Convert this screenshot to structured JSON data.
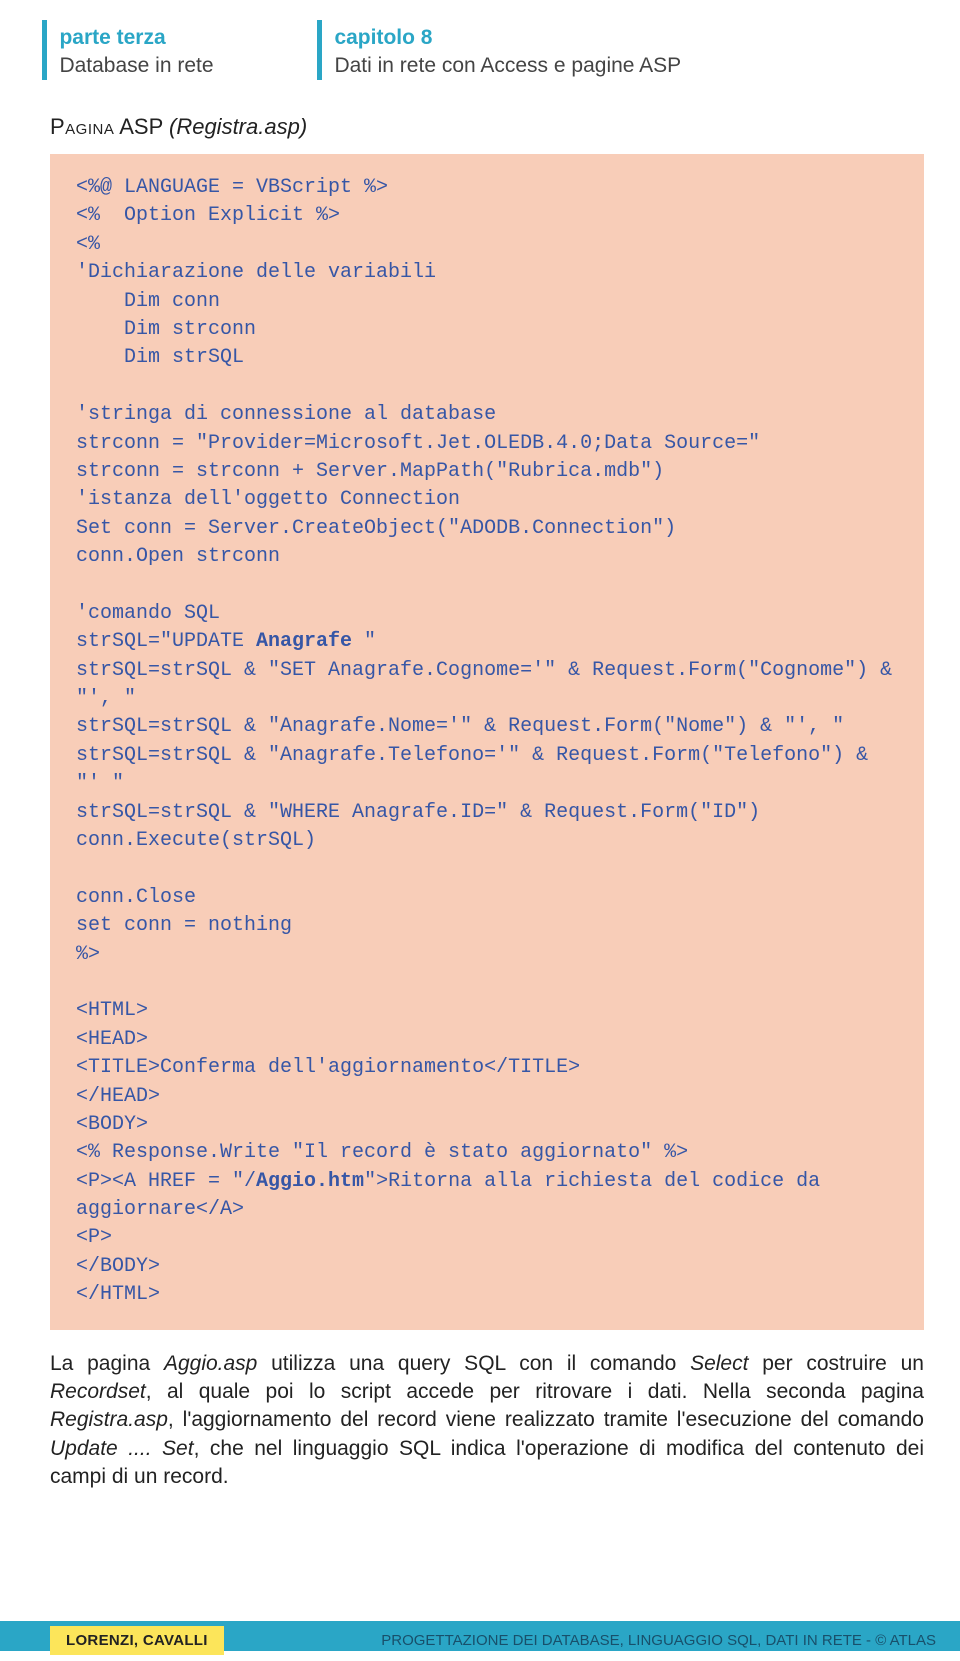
{
  "header": {
    "left": {
      "part_label": "parte terza",
      "sub_label": "Database in rete"
    },
    "right": {
      "chapter_label": "capitolo 8",
      "sub_label": "Dati in rete con Access e pagine ASP"
    }
  },
  "page_title": {
    "smallcaps": "Pagina",
    "rest": " ASP ",
    "italic": "(Registra.asp)"
  },
  "code": {
    "block1": "<%@ LANGUAGE = VBScript %>\n<%  Option Explicit %>\n<%\n'Dichiarazione delle variabili\n    Dim conn\n    Dim strconn\n    Dim strSQL\n\n'stringa di connessione al database\nstrconn = \"Provider=Microsoft.Jet.OLEDB.4.0;Data Source=\"\nstrconn = strconn + Server.MapPath(\"Rubrica.mdb\")\n'istanza dell'oggetto Connection\nSet conn = Server.CreateObject(\"ADODB.Connection\")\nconn.Open strconn\n\n'comando SQL\nstrSQL=\"UPDATE ",
    "bold1": "Anagrafe",
    "block2": " \"\nstrSQL=strSQL & \"SET Anagrafe.Cognome='\" & Request.Form(\"Cognome\") & \"', \"\nstrSQL=strSQL & \"Anagrafe.Nome='\" & Request.Form(\"Nome\") & \"', \"\nstrSQL=strSQL & \"Anagrafe.Telefono='\" & Request.Form(\"Telefono\") & \"' \"\nstrSQL=strSQL & \"WHERE Anagrafe.ID=\" & Request.Form(\"ID\")\nconn.Execute(strSQL)\n\nconn.Close\nset conn = nothing\n%>\n\n<HTML>\n<HEAD>\n<TITLE>Conferma dell'aggiornamento</TITLE>\n</HEAD>\n<BODY>\n<% Response.Write \"Il record è stato aggiornato\" %>\n<P><A HREF = \"/",
    "bold2": "Aggio.htm",
    "block3": "\">Ritorna alla richiesta del codice da aggiornare</A>\n<P>\n</BODY>\n</HTML>"
  },
  "body_paragraph": {
    "t1": "La pagina ",
    "i1": "Aggio.asp",
    "t2": " utilizza una query SQL con il comando ",
    "i2": "Select",
    "t3": " per costruire un ",
    "i3": "Recordset",
    "t4": ", al quale poi lo script accede per ritrovare i dati. Nella seconda pagina ",
    "i4": "Registra.asp",
    "t5": ", l'aggiornamento del record viene realizzato tramite l'esecuzione del comando ",
    "i5": "Update .... Set",
    "t6": ", che nel linguaggio SQL indica l'operazione di modifica del contenuto dei campi di un record."
  },
  "footer": {
    "left": "LORENZI, CAVALLI",
    "right": "PROGETTAZIONE DEI DATABASE, LINGUAGGIO SQL, DATI IN RETE - © ATLAS"
  }
}
